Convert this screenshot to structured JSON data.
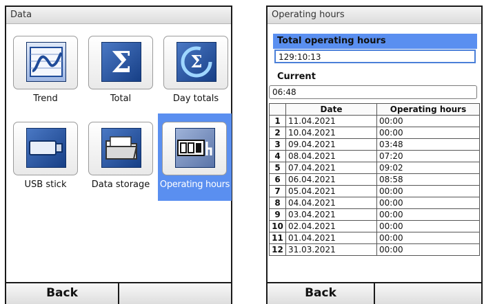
{
  "left_screen": {
    "title": "Data",
    "tiles": [
      {
        "label": "Trend",
        "icon": "trend-chart-icon"
      },
      {
        "label": "Total",
        "icon": "sigma-icon"
      },
      {
        "label": "Day totals",
        "icon": "day-total-sigma-icon"
      },
      {
        "label": "USB stick",
        "icon": "usb-stick-icon"
      },
      {
        "label": "Data storage",
        "icon": "folder-icon"
      },
      {
        "label": "Operating hours",
        "icon": "hour-counter-icon",
        "selected": true
      }
    ],
    "softkeys": [
      "Back",
      ""
    ]
  },
  "right_screen": {
    "title": "Operating hours",
    "total_label": "Total operating hours",
    "total_value": "129:10:13",
    "current_label": "Current",
    "current_value": "06:48",
    "table": {
      "headers": [
        "",
        "Date",
        "Operating hours"
      ],
      "rows": [
        [
          "1",
          "11.04.2021",
          "00:00"
        ],
        [
          "2",
          "10.04.2021",
          "00:00"
        ],
        [
          "3",
          "09.04.2021",
          "03:48"
        ],
        [
          "4",
          "08.04.2021",
          "07:20"
        ],
        [
          "5",
          "07.04.2021",
          "09:02"
        ],
        [
          "6",
          "06.04.2021",
          "08:58"
        ],
        [
          "7",
          "05.04.2021",
          "00:00"
        ],
        [
          "8",
          "04.04.2021",
          "00:00"
        ],
        [
          "9",
          "03.04.2021",
          "00:00"
        ],
        [
          "10",
          "02.04.2021",
          "00:00"
        ],
        [
          "11",
          "01.04.2021",
          "00:00"
        ],
        [
          "12",
          "31.03.2021",
          "00:00"
        ]
      ]
    },
    "softkeys": [
      "Back",
      ""
    ]
  },
  "colors": {
    "selection": "#5a8ff0",
    "icon_blue": "#1f4b99",
    "border": "#1a1a1a"
  }
}
